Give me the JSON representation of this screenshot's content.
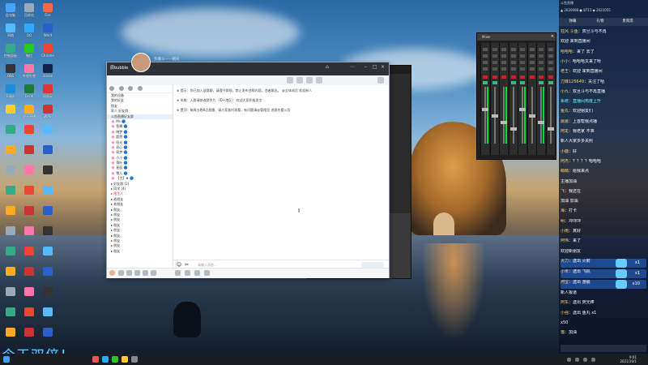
{
  "banner_text": "今天双倍！",
  "desktop_icons": [
    {
      "label": "此电脑",
      "color": "#4aa3ff"
    },
    {
      "label": "回收站",
      "color": "#9ab"
    },
    {
      "label": "Fire",
      "color": "#f64"
    },
    {
      "label": "网络",
      "color": "#5bf"
    },
    {
      "label": "QQ",
      "color": "#2fa9ff"
    },
    {
      "label": "Word",
      "color": "#2b5fc9"
    },
    {
      "label": "控制面板",
      "color": "#3a8"
    },
    {
      "label": "微信",
      "color": "#2c2"
    },
    {
      "label": "Chrome",
      "color": "#e43"
    },
    {
      "label": "OBS",
      "color": "#333"
    },
    {
      "label": "哔哩哔哩",
      "color": "#f7a"
    },
    {
      "label": "Steam",
      "color": "#124"
    },
    {
      "label": "Edge",
      "color": "#1a8cd8"
    },
    {
      "label": "Excel",
      "color": "#1f7a3a"
    },
    {
      "label": "网易云",
      "color": "#d33"
    },
    {
      "label": "YY",
      "color": "#fc3"
    },
    {
      "label": "虎牙直播",
      "color": "#fa2"
    },
    {
      "label": "WPS",
      "color": "#c33"
    }
  ],
  "qq": {
    "title": "凯撒斗——朝天",
    "username": "辰bubble",
    "groups": [
      {
        "label": "我的设备",
        "hl": false,
        "red": false
      },
      {
        "label": "我的好友",
        "hl": false,
        "red": false
      },
      {
        "label": "朋友",
        "hl": false,
        "red": false
      },
      {
        "label": "家人 好友群",
        "hl": false,
        "red": false
      },
      {
        "label": "斗鱼直播好友群",
        "hl": true,
        "red": false
      },
      {
        "label": "🌸 Ms 🔵",
        "hl": false,
        "red": false
      },
      {
        "label": "🌸 鱼酱 🔵",
        "hl": false,
        "red": false
      },
      {
        "label": "🌸 晓梦 🔵",
        "hl": false,
        "red": false
      },
      {
        "label": "🌸 超然 🔵",
        "hl": false,
        "red": false
      },
      {
        "label": "🌸 阳光 🔵",
        "hl": false,
        "red": false
      },
      {
        "label": "🌸 初心 🔵",
        "hl": false,
        "red": false
      },
      {
        "label": "🌸 如梦 🔵",
        "hl": false,
        "red": false
      },
      {
        "label": "🌸 小小 🔵",
        "hl": false,
        "red": false
      },
      {
        "label": "🌸 落叶 🔵",
        "hl": false,
        "red": false
      },
      {
        "label": "🌸 星辰 🔵",
        "hl": false,
        "red": false
      },
      {
        "label": "🌸 雪儿 🔵",
        "hl": false,
        "red": false
      },
      {
        "label": "🌸 【主】★ 🔵",
        "hl": false,
        "red": false
      },
      {
        "label": "▸ 好友群 (2)",
        "hl": false,
        "red": false
      },
      {
        "label": "▸ 同学 (4)",
        "hl": false,
        "red": false
      },
      {
        "label": "▸ 陌生人",
        "hl": false,
        "red": true
      },
      {
        "label": "▸ 老朋友",
        "hl": false,
        "red": false
      },
      {
        "label": "▸ 老朋友",
        "hl": false,
        "red": false
      },
      {
        "label": "▸ 朋友",
        "hl": false,
        "red": false
      },
      {
        "label": "▸ 朋友",
        "hl": false,
        "red": false
      },
      {
        "label": "▸ 朋友",
        "hl": false,
        "red": false
      },
      {
        "label": "▸ 朋友",
        "hl": false,
        "red": false
      },
      {
        "label": "▸ 朋友",
        "hl": false,
        "red": false
      },
      {
        "label": "▸ 朋友",
        "hl": false,
        "red": false
      },
      {
        "label": "▸ 朋友",
        "hl": false,
        "red": false
      },
      {
        "label": "▸ 朋友",
        "hl": false,
        "red": false
      },
      {
        "label": "▸ 朋友",
        "hl": false,
        "red": false
      }
    ],
    "messages": [
      "⊕ 提示：你已加入该群聊，请遵守群规，禁止发布违规内容，违者踢出。  @全体成员 欢迎新人",
      "⊕ 系统：入群请修改群名片（ID+地区）  欢迎大家积极发言",
      "⊕ 置顶：每周五晚8点直播，请大家准时观看，有问题请@管理员  进群先看公告"
    ],
    "input_placeholder": "请输入消息..."
  },
  "mixer": {
    "title": "Mixer"
  },
  "chat": {
    "header": "斗鱼直播",
    "stats": "▲ 2020088   ● 8715   ◆ 2021055",
    "tabs": [
      "弹幕",
      "礼物",
      "贵宾席"
    ],
    "messages": [
      {
        "name": "狂风 斗鱼",
        "text": "：双旦斗与不再",
        "type": "msg"
      },
      {
        "name": "",
        "text": "欢迎 来到直播间",
        "type": "msg"
      },
      {
        "name": "哈哈哈",
        "text": "：来了 去了",
        "type": "msg"
      },
      {
        "name": "小小",
        "text": "：哈哈哈又来了呀",
        "type": "msg"
      },
      {
        "name": "老王",
        "text": "：欢迎 来到直播间",
        "type": "msg"
      },
      {
        "name": "刀锋125649",
        "text": "：关注了哈",
        "type": "msg"
      },
      {
        "name": "小九",
        "text": "：双旦斗与不再直播",
        "type": "msg"
      },
      {
        "name": "",
        "text": "系统：直播间热度上升",
        "type": "cyan"
      },
      {
        "name": "鱼丸",
        "text": "：欢迎朋友们",
        "type": "msg"
      },
      {
        "name": "晨晨",
        "text": "：上首帮我点播",
        "type": "msg"
      },
      {
        "name": "阿龙",
        "text": "：我老家 不准",
        "type": "msg"
      },
      {
        "name": "",
        "text": "新人大家多多关照",
        "type": "msg"
      },
      {
        "name": "小鹿",
        "text": "：好",
        "type": "msg"
      },
      {
        "name": "阿杰",
        "text": "：？？？？哈哈哈",
        "type": "msg"
      },
      {
        "name": "萌萌",
        "text": "：给我来点",
        "type": "msg"
      },
      {
        "name": "",
        "text": "主播加油",
        "type": "msg"
      },
      {
        "name": "飞",
        "text": "：我还在",
        "type": "msg"
      },
      {
        "name": "",
        "text": "加油 加油",
        "type": "msg"
      },
      {
        "name": "海",
        "text": "：打卡",
        "type": "msg"
      },
      {
        "name": "明",
        "text": "：冲冲冲",
        "type": "msg"
      },
      {
        "name": "小雨",
        "text": "：真好",
        "type": "msg"
      },
      {
        "name": "阿伟",
        "text": "：来了",
        "type": "msg"
      },
      {
        "name": "",
        "text": "欢迎新朋友",
        "type": "msg"
      },
      {
        "name": "大力",
        "text": "：送出 火箭",
        "type": "gift",
        "count": "x1"
      },
      {
        "name": "小米",
        "text": "：送出 飞机",
        "type": "gift",
        "count": "x1"
      },
      {
        "name": "阿宝",
        "text": "：送出 游艇",
        "type": "gift",
        "count": "x10"
      },
      {
        "name": "",
        "text": "新人报道",
        "type": "msg"
      },
      {
        "name": "阿东",
        "text": "：送出 荧光棒",
        "type": "msg"
      },
      {
        "name": "小强",
        "text": "：送出 鱼丸 x1",
        "type": "msg"
      },
      {
        "name": "",
        "text": "x50",
        "type": "msg"
      },
      {
        "name": "猫",
        "text": "：加油",
        "type": "msg"
      }
    ]
  },
  "clock": {
    "time": "9:01",
    "date": "2021/10/1"
  }
}
